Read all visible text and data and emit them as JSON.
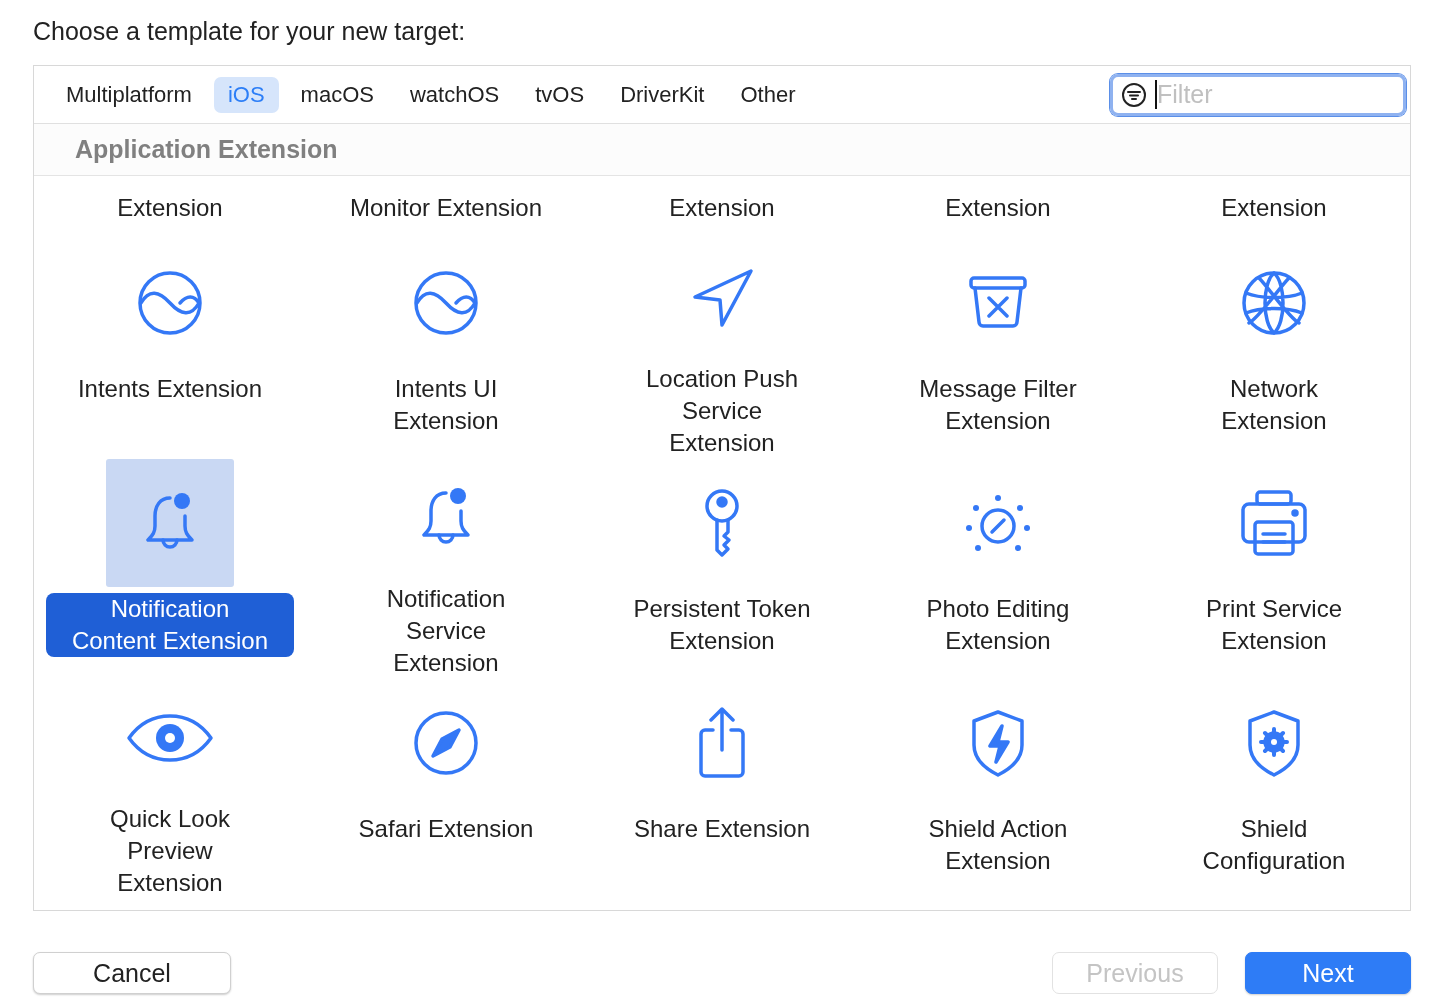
{
  "title": "Choose a template for your new target:",
  "tabs": [
    {
      "label": "Multiplatform",
      "selected": false
    },
    {
      "label": "iOS",
      "selected": true
    },
    {
      "label": "macOS",
      "selected": false
    },
    {
      "label": "watchOS",
      "selected": false
    },
    {
      "label": "tvOS",
      "selected": false
    },
    {
      "label": "DriverKit",
      "selected": false
    },
    {
      "label": "Other",
      "selected": false
    }
  ],
  "filter": {
    "placeholder": "Filter"
  },
  "section": "Application Extension",
  "partial_row": [
    "Extension",
    "Monitor Extension",
    "Extension",
    "Extension",
    "Extension"
  ],
  "templates": [
    {
      "name": "Intents Extension",
      "kind": "intents",
      "selected": false
    },
    {
      "name": "Intents UI Extension",
      "kind": "intents",
      "selected": false
    },
    {
      "name": "Location Push Service Extension",
      "kind": "location",
      "selected": false
    },
    {
      "name": "Message Filter Extension",
      "kind": "filter",
      "selected": false
    },
    {
      "name": "Network Extension",
      "kind": "network",
      "selected": false
    },
    {
      "name": "Notification Content Extension",
      "kind": "notification",
      "selected": true
    },
    {
      "name": "Notification Service Extension",
      "kind": "notification",
      "selected": false
    },
    {
      "name": "Persistent Token Extension",
      "kind": "token",
      "selected": false
    },
    {
      "name": "Photo Editing Extension",
      "kind": "photo",
      "selected": false
    },
    {
      "name": "Print Service Extension",
      "kind": "print",
      "selected": false
    },
    {
      "name": "Quick Look Preview Extension",
      "kind": "preview",
      "selected": false
    },
    {
      "name": "Safari Extension",
      "kind": "safari",
      "selected": false
    },
    {
      "name": "Share Extension",
      "kind": "share",
      "selected": false
    },
    {
      "name": "Shield Action Extension",
      "kind": "shieldaction",
      "selected": false
    },
    {
      "name": "Shield Configuration",
      "kind": "shieldconfig",
      "selected": false
    }
  ],
  "buttons": [
    {
      "label": "Cancel",
      "kind": "normal",
      "disabled": false
    },
    {
      "label": "Previous",
      "kind": "normal",
      "disabled": true
    },
    {
      "label": "Next",
      "kind": "primary",
      "disabled": false
    }
  ]
}
